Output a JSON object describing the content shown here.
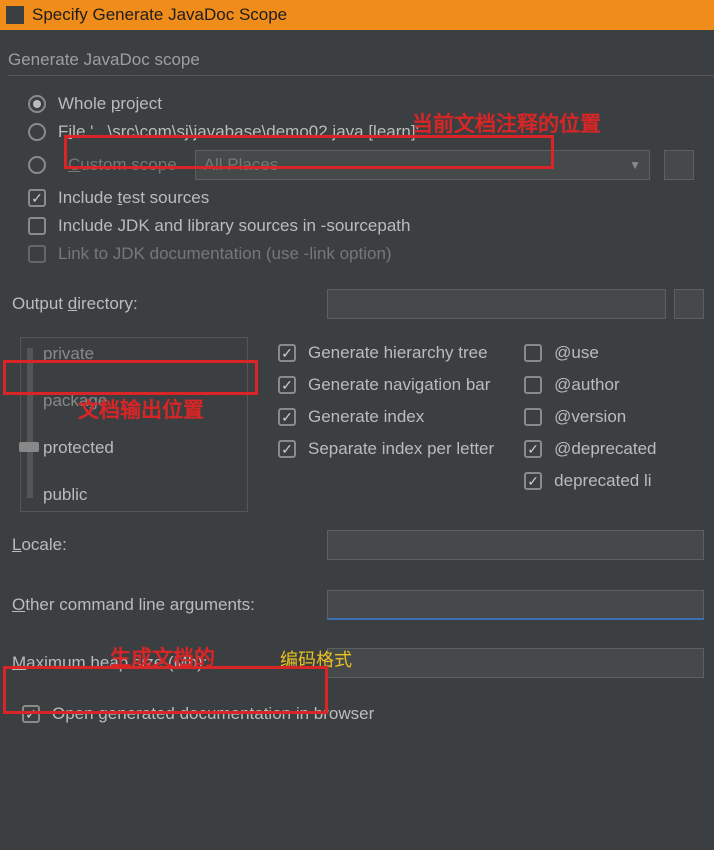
{
  "title": "Specify Generate JavaDoc Scope",
  "section": "Generate JavaDoc scope",
  "scope": {
    "whole": {
      "pre": "Whole ",
      "u": "p",
      "post": "roject"
    },
    "file": {
      "pre": "F",
      "u": "i",
      "post": "le '...\\src\\com\\sj\\javabase\\demo02.java [learn]'"
    },
    "custom": {
      "u": "C",
      "post": "ustom scope"
    },
    "combo": "All Places",
    "include_test": {
      "pre": "Include ",
      "u": "t",
      "post": "est sources"
    },
    "include_jdk": "Include JDK and library sources in -sourcepath",
    "link_jdk": "Link to JDK documentation (use -link option)"
  },
  "output": {
    "pre": "Output ",
    "u": "d",
    "post": "irectory:"
  },
  "visibility": {
    "private": "private",
    "package": "package",
    "protected": "protected",
    "public": "public"
  },
  "generate": {
    "hierarchy": "Generate hierarchy tree",
    "navbar": "Generate navigation bar",
    "index": "Generate index",
    "separate": "Separate index per letter"
  },
  "tags": {
    "use": "@use",
    "author": "@author",
    "version": "@version",
    "deprecated": "@deprecated",
    "deplist": "deprecated li"
  },
  "locale": {
    "u": "L",
    "post": "ocale:"
  },
  "other": {
    "u": "O",
    "post": "ther command line arguments:"
  },
  "heap": {
    "u": "M",
    "post": "aximum heap size (Mb):"
  },
  "open": "Open generated documentation in browser",
  "annotations": {
    "a1": "当前文档注释的位置",
    "a2": "文档输出位置",
    "a3": "生成文档的",
    "a4": "编码格式"
  }
}
